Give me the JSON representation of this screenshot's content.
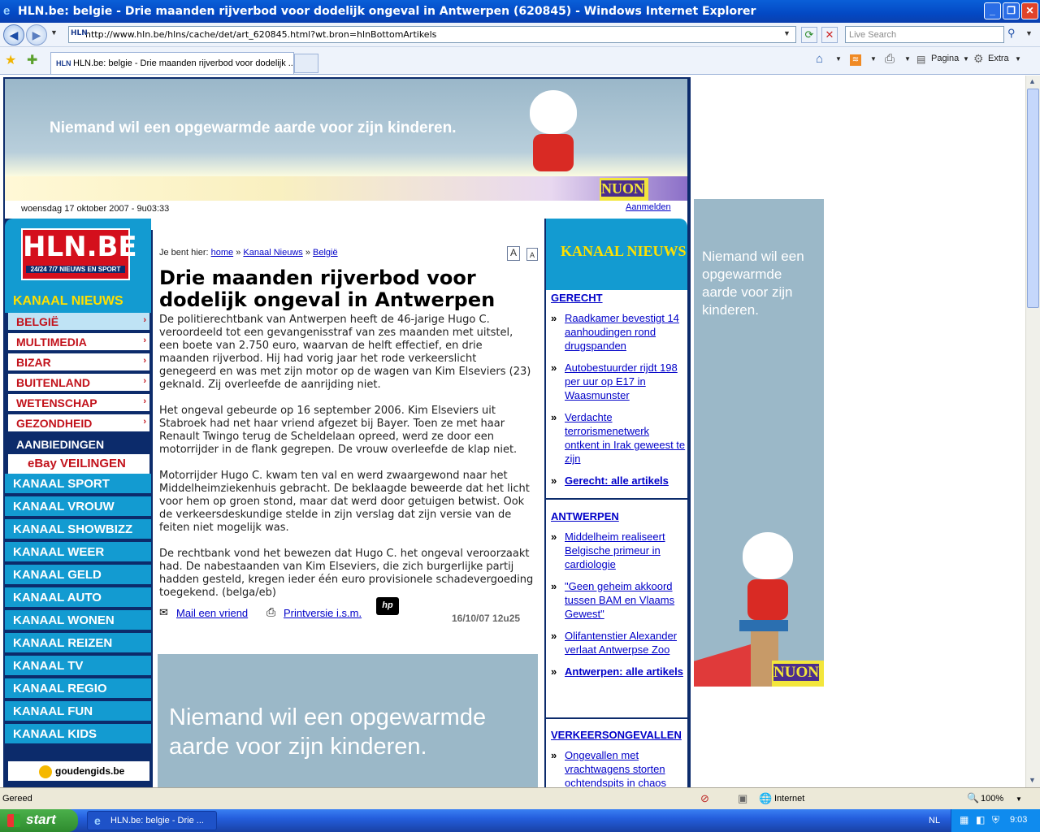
{
  "window": {
    "title": "HLN.be: belgie - Drie maanden rijverbod voor dodelijk ongeval in Antwerpen (620845) - Windows Internet Explorer"
  },
  "address": {
    "url": "http://www.hln.be/hlns/cache/det/art_620845.html?wt.bron=hlnBottomArtikels",
    "search_placeholder": "Live Search"
  },
  "tabs": {
    "active": "HLN.be: belgie - Drie maanden rijverbod voor dodelijk ...",
    "home": "",
    "pagina": "Pagina",
    "extra": "Extra"
  },
  "banner": {
    "text": "Niemand wil een opgewarmde aarde voor zijn kinderen.",
    "brand": "NUON"
  },
  "datebar": {
    "date": "woensdag 17 oktober 2007 -  9u03:33",
    "login": "Aanmelden"
  },
  "logo": {
    "name": "HLN.BE",
    "tagline": "24/24 7/7 NIEUWS EN SPORT"
  },
  "left_nav": {
    "kanaal_nieuws": "KANAAL NIEUWS",
    "subitems": [
      "BELGIË",
      "MULTIMEDIA",
      "BIZAR",
      "BUITENLAND",
      "WETENSCHAP",
      "GEZONDHEID"
    ],
    "aanbiedingen": "AANBIEDINGEN",
    "ebay": "eBay VEILINGEN",
    "kanalen": [
      "KANAAL SPORT",
      "KANAAL VROUW",
      "KANAAL SHOWBIZZ",
      "KANAAL WEER",
      "KANAAL GELD",
      "KANAAL AUTO",
      "KANAAL WONEN",
      "KANAAL REIZEN",
      "KANAAL TV",
      "KANAAL REGIO",
      "KANAAL FUN",
      "KANAAL KIDS"
    ],
    "goudengids": "goudengids.be"
  },
  "breadcrumb": {
    "prefix": "Je bent hier:",
    "home": "home",
    "sep": "»",
    "kanaal": "Kanaal Nieuws",
    "belgie": "België"
  },
  "article": {
    "title": "Drie maanden rijverbod voor dodelijk ongeval in Antwerpen",
    "paragraphs": [
      "De politierechtbank van Antwerpen heeft de 46-jarige Hugo C. veroordeeld tot een gevangenisstraf van zes maanden met uitstel, een boete van 2.750 euro, waarvan de helft effectief, en drie maanden rijverbod. Hij had vorig jaar het rode verkeerslicht genegeerd en was met zijn motor op de wagen van Kim Elseviers (23) geknald. Zij overleefde de aanrijding niet.",
      "Het ongeval gebeurde op 16 september 2006. Kim Elseviers uit Stabroek had net haar vriend afgezet bij Bayer. Toen ze met haar Renault Twingo terug de Scheldelaan opreed, werd ze door een motorrijder in de flank gegrepen. De vrouw overleefde de klap niet.",
      "Motorrijder Hugo C. kwam ten val en werd zwaargewond naar het Middelheimziekenhuis gebracht. De beklaagde beweerde dat het licht voor hem op groen stond, maar dat werd door getuigen betwist. Ook de verkeersdeskundige stelde in zijn verslag dat zijn versie van de feiten niet mogelijk was.",
      "De rechtbank vond het bewezen dat Hugo C. het ongeval veroorzaakt had. De nabestaanden van Kim Elseviers, die zich burgerlijke partij hadden gesteld, kregen ieder één euro provisionele schadevergoeding toegekend. (belga/eb)"
    ],
    "mail": "Mail een vriend",
    "print": "Printversie i.s.m.",
    "timestamp": "16/10/07 12u25",
    "font_large": "A",
    "font_small": "A"
  },
  "right": {
    "kanaal": "KANAAL NIEUWS",
    "sections": [
      {
        "title": "GERECHT",
        "items": [
          "Raadkamer bevestigt 14 aanhoudingen rond drugspanden",
          "Autobestuurder rijdt 198 per uur op E17 in Waasmunster",
          "Verdachte terrorismenetwerk ontkent in Irak geweest te zijn"
        ],
        "all": "Gerecht: alle artikels"
      },
      {
        "title": "ANTWERPEN",
        "items": [
          "Middelheim realiseert Belgische primeur in cardiologie",
          "\"Geen geheim akkoord tussen BAM en Vlaams Gewest\"",
          "Olifantenstier Alexander verlaat Antwerpse Zoo"
        ],
        "all": "Antwerpen: alle artikels"
      },
      {
        "title": "VERKEERSONGEVALLEN",
        "items": [
          "Ongevallen met vrachtwagens storten ochtendspits in chaos"
        ]
      }
    ]
  },
  "side_ad": {
    "text": "Niemand wil een opgewarmde aarde voor zijn kinderen.",
    "brand": "NUON"
  },
  "bottom_ad": {
    "text": "Niemand wil een opgewarmde aarde voor zijn kinderen."
  },
  "status": {
    "text": "Gereed",
    "zone": "Internet",
    "zoom": "100%"
  },
  "taskbar": {
    "start": "start",
    "item": "HLN.be: belgie - Drie ...",
    "lang": "NL",
    "clock": "9:03"
  }
}
